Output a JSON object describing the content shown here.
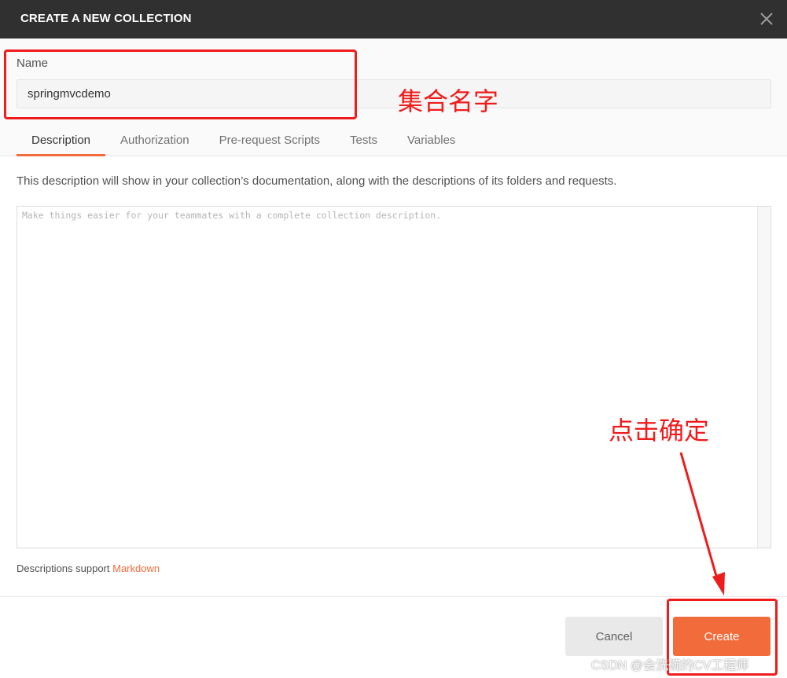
{
  "dialog": {
    "title": "CREATE A NEW COLLECTION",
    "close_icon": "close-icon"
  },
  "name": {
    "label": "Name",
    "value": "springmvcdemo"
  },
  "tabs": [
    {
      "label": "Description",
      "active": true
    },
    {
      "label": "Authorization",
      "active": false
    },
    {
      "label": "Pre-request Scripts",
      "active": false
    },
    {
      "label": "Tests",
      "active": false
    },
    {
      "label": "Variables",
      "active": false
    }
  ],
  "description": {
    "hint": "This description will show in your collection’s documentation, along with the descriptions of its folders and requests.",
    "placeholder": "Make things easier for your teammates with a complete collection description.",
    "markdown_note": "Descriptions support ",
    "markdown_link": "Markdown"
  },
  "footer": {
    "cancel_label": "Cancel",
    "create_label": "Create"
  },
  "annotations": {
    "name_note": "集合名字",
    "create_note": "点击确定",
    "color": "#ee1c1c"
  },
  "watermark": "CSDN @会洗碗的CV工程师",
  "colors": {
    "accent": "#f26b3a",
    "titlebar": "#303030"
  }
}
